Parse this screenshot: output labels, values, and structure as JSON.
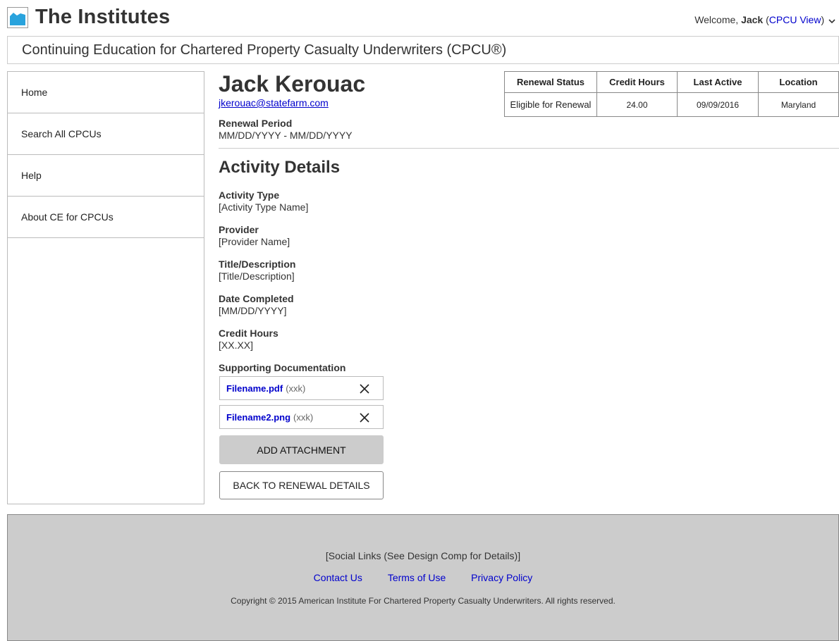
{
  "header": {
    "brand": "The Institutes",
    "welcome_prefix": "Welcome, ",
    "user_name": "Jack",
    "view_link": "CPCU View",
    "paren_open": " (",
    "paren_close": ")",
    "subtitle": "Continuing Education for Chartered Property Casualty Underwriters (CPCU®)"
  },
  "sidebar": {
    "items": [
      {
        "label": "Home"
      },
      {
        "label": "Search All CPCUs"
      },
      {
        "label": "Help"
      },
      {
        "label": "About CE for CPCUs"
      }
    ]
  },
  "profile": {
    "name": "Jack Kerouac",
    "email": "jkerouac@statefarm.com",
    "renewal_period_label": "Renewal Period",
    "renewal_period_value": "MM/DD/YYYY - MM/DD/YYYY"
  },
  "status_table": {
    "headers": [
      "Renewal Status",
      "Credit Hours",
      "Last Active",
      "Location"
    ],
    "row": [
      "Eligible for Renewal",
      "24.00",
      "09/09/2016",
      "Maryland"
    ]
  },
  "activity": {
    "title": "Activity Details",
    "fields": [
      {
        "label": "Activity Type",
        "value": "[Activity Type Name]"
      },
      {
        "label": "Provider",
        "value": "[Provider Name]"
      },
      {
        "label": "Title/Description",
        "value": "[Title/Description]"
      },
      {
        "label": "Date Completed",
        "value": "[MM/DD/YYYY]"
      },
      {
        "label": "Credit Hours",
        "value": "[XX.XX]"
      }
    ],
    "docs_label": "Supporting Documentation",
    "attachments": [
      {
        "name": "Filename.pdf",
        "size": "(xxk)"
      },
      {
        "name": "Filename2.png",
        "size": "(xxk)"
      }
    ],
    "add_button": "ADD ATTACHMENT",
    "back_button": "BACK TO RENEWAL DETAILS"
  },
  "footer": {
    "social": "[Social Links (See Design Comp for Details)]",
    "links": [
      "Contact Us",
      "Terms of Use",
      "Privacy Policy"
    ],
    "copyright": "Copyright © 2015 American Institute For Chartered Property Casualty Underwriters. All rights reserved."
  },
  "colors": {
    "logo_blue": "#29a3dd",
    "link_blue": "#0000cc",
    "footer_gray": "#cccccc"
  },
  "icons": {
    "logo": "image-icon",
    "user_menu": "chevron-down-icon",
    "remove_attachment": "close-icon"
  }
}
